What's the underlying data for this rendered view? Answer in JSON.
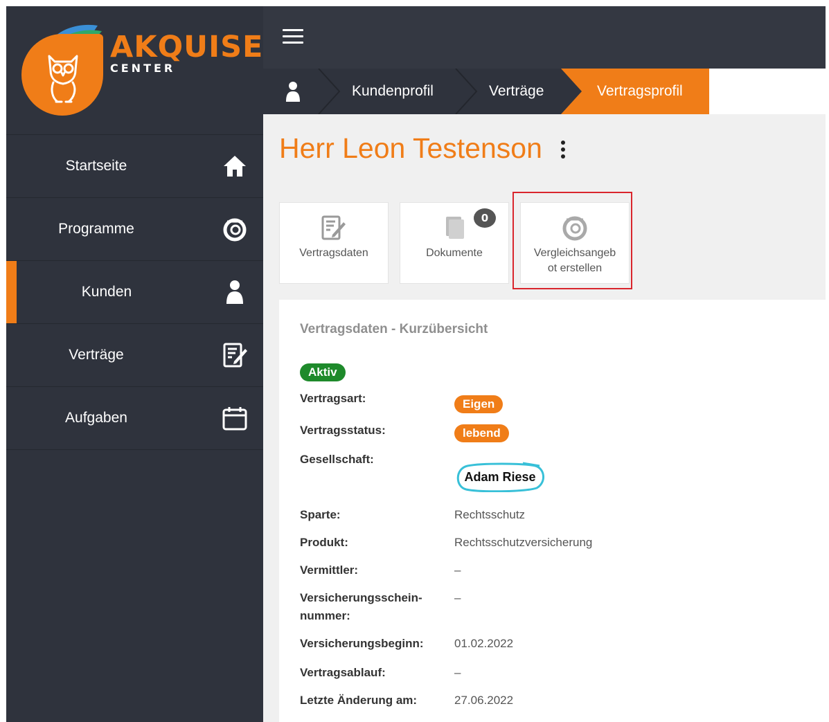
{
  "brand": {
    "name": "AKQUISE",
    "sub": "CENTER",
    "accent": "#f07d18",
    "dark": "#2f333d"
  },
  "nav": [
    {
      "label": "Startseite",
      "icon": "home-icon"
    },
    {
      "label": "Programme",
      "icon": "ring-icon"
    },
    {
      "label": "Kunden",
      "icon": "user-icon",
      "active": true
    },
    {
      "label": "Verträge",
      "icon": "contract-edit-icon"
    },
    {
      "label": "Aufgaben",
      "icon": "calendar-icon"
    }
  ],
  "breadcrumb": {
    "items": [
      "Kundenprofil",
      "Verträge",
      "Vertragsprofil"
    ]
  },
  "customer": {
    "name": "Herr Leon Testenson"
  },
  "tiles": [
    {
      "label": "Vertragsdaten",
      "icon": "contract-edit-icon"
    },
    {
      "label": "Dokumente",
      "icon": "documents-icon",
      "badge": "0"
    },
    {
      "label": "Vergleichsangeb ot erstellen",
      "line1": "Vergleichsangeb",
      "line2": "ot erstellen",
      "icon": "ring-icon"
    }
  ],
  "panel": {
    "title": "Vertragsdaten - Kurzübersicht",
    "status": "Aktiv",
    "fields": [
      {
        "label": "Vertragsart:",
        "value": "Eigen",
        "kind": "badge"
      },
      {
        "label": "Vertragsstatus:",
        "value": "lebend",
        "kind": "badge"
      },
      {
        "label": "Gesellschaft:",
        "value": "Adam Riese",
        "kind": "logo"
      },
      {
        "label": "Sparte:",
        "value": "Rechtsschutz"
      },
      {
        "label": "Produkt:",
        "value": "Rechtsschutzversicherung"
      },
      {
        "label": "Vermittler:",
        "value": "–"
      },
      {
        "label": "Versicherungsschein-",
        "label2": "nummer:",
        "value": "–"
      },
      {
        "label": "Versicherungsbeginn:",
        "value": "01.02.2022"
      },
      {
        "label": "Vertragsablauf:",
        "value": "–"
      },
      {
        "label": "Letzte Änderung am:",
        "value": "27.06.2022"
      }
    ]
  }
}
